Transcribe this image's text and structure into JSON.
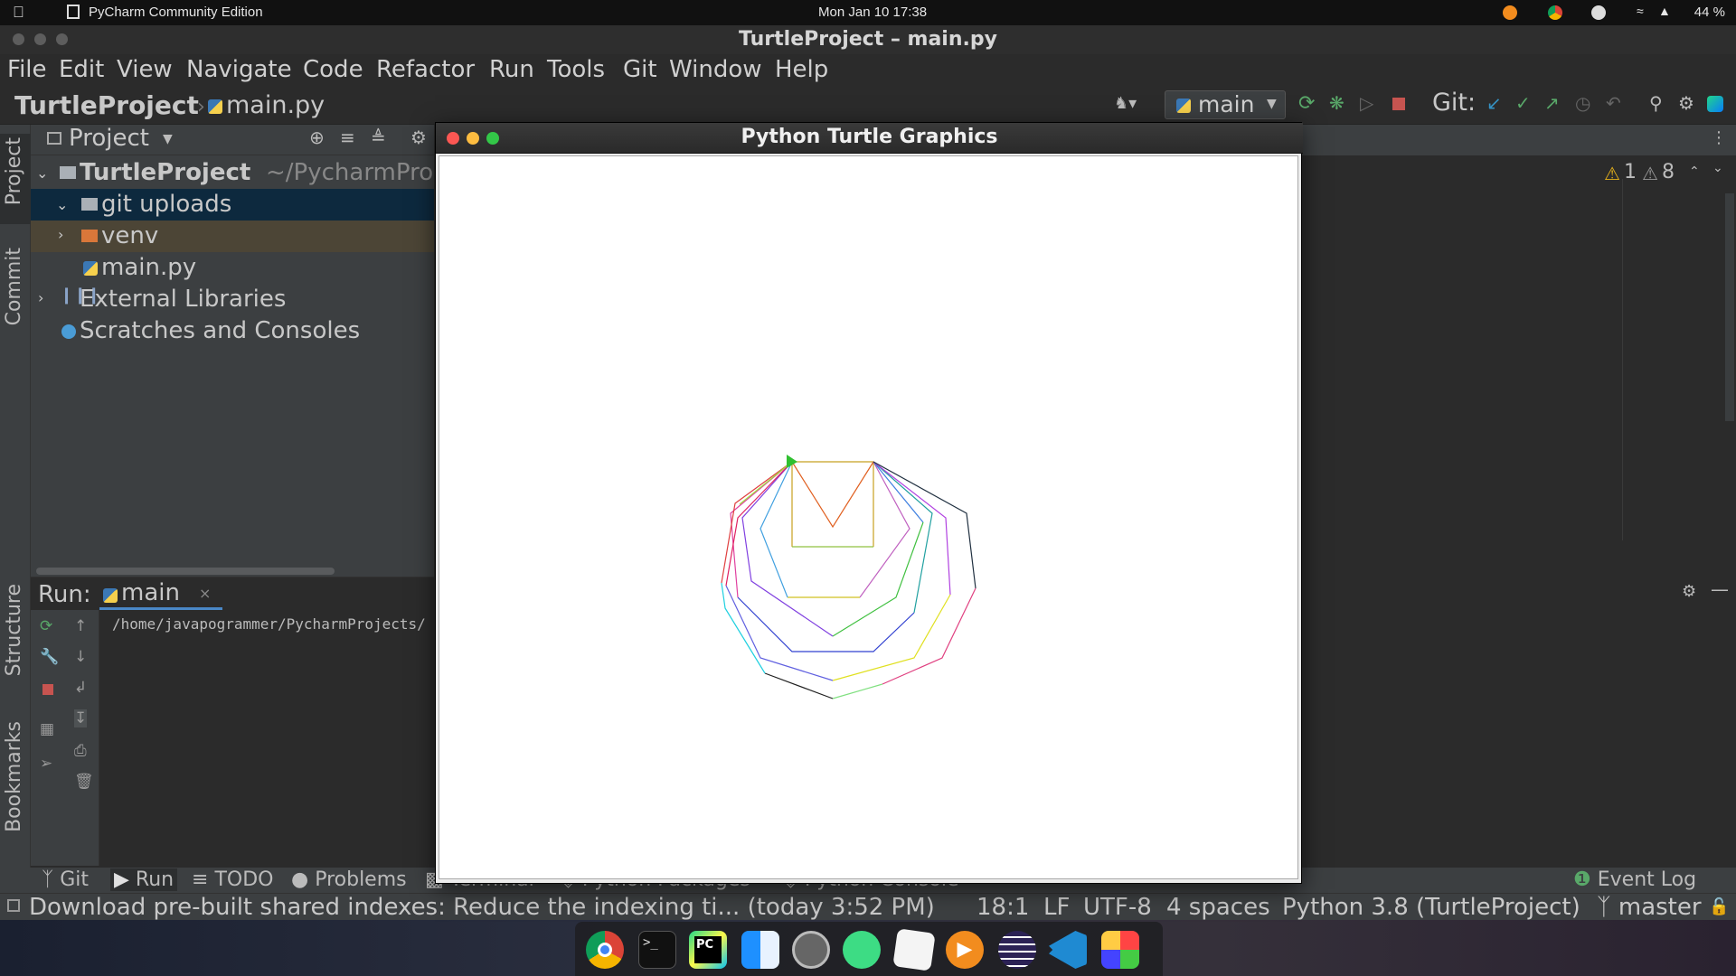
{
  "system_bar": {
    "apple_icon": "apple-icon",
    "app_name": "PyCharm Community Edition",
    "clock": "Mon Jan 10  17:38",
    "battery": "44 %"
  },
  "window": {
    "title": "TurtleProject – main.py"
  },
  "menu": [
    "File",
    "Edit",
    "View",
    "Navigate",
    "Code",
    "Refactor",
    "Run",
    "Tools",
    "Git",
    "Window",
    "Help"
  ],
  "navbar": {
    "project": "TurtleProject",
    "file": "main.py",
    "run_config": "main",
    "git_label": "Git:"
  },
  "left_tabs": {
    "project": "Project",
    "commit": "Commit",
    "structure": "Structure",
    "bookmarks": "Bookmarks"
  },
  "project_panel": {
    "title": "Project",
    "tree": [
      {
        "label": "TurtleProject",
        "path": "~/PycharmPro",
        "indent": 0,
        "type": "folder",
        "expanded": true
      },
      {
        "label": "git uploads",
        "indent": 1,
        "type": "folder",
        "expanded": true,
        "selected": true
      },
      {
        "label": "venv",
        "indent": 1,
        "type": "folder-orange",
        "expanded": false
      },
      {
        "label": "main.py",
        "indent": 2,
        "type": "python"
      },
      {
        "label": "External Libraries",
        "indent": 0,
        "type": "libs"
      },
      {
        "label": "Scratches and Consoles",
        "indent": 0,
        "type": "scratch"
      }
    ]
  },
  "editor": {
    "warnings": "1",
    "weak_warnings": "8"
  },
  "run_panel": {
    "label": "Run:",
    "tab": "main",
    "output": "/home/javapogrammer/PycharmProjects/"
  },
  "turtle_window": {
    "title": "Python Turtle Graphics",
    "colors": {
      "close": "#fc5753",
      "min": "#fdbc40",
      "max": "#33c748"
    }
  },
  "bottom_tabs": [
    "Git",
    "Run",
    "TODO",
    "Problems",
    "Terminal",
    "Python Packages",
    "Python Console"
  ],
  "event_log": "Event Log",
  "status": {
    "message": "Download pre-built shared indexes: Reduce the indexing ti... (today 3:52 PM)",
    "position": "18:1",
    "line_sep": "LF",
    "encoding": "UTF-8",
    "indent": "4 spaces",
    "interpreter": "Python 3.8 (TurtleProject)",
    "branch": "master"
  },
  "dock_icons": [
    "chrome-icon",
    "terminal-icon",
    "pycharm-icon",
    "finder-icon",
    "settings-icon",
    "android-studio-icon",
    "notes-icon",
    "vlc-icon",
    "eclipse-icon",
    "vscode-icon",
    "launchpad-icon"
  ]
}
